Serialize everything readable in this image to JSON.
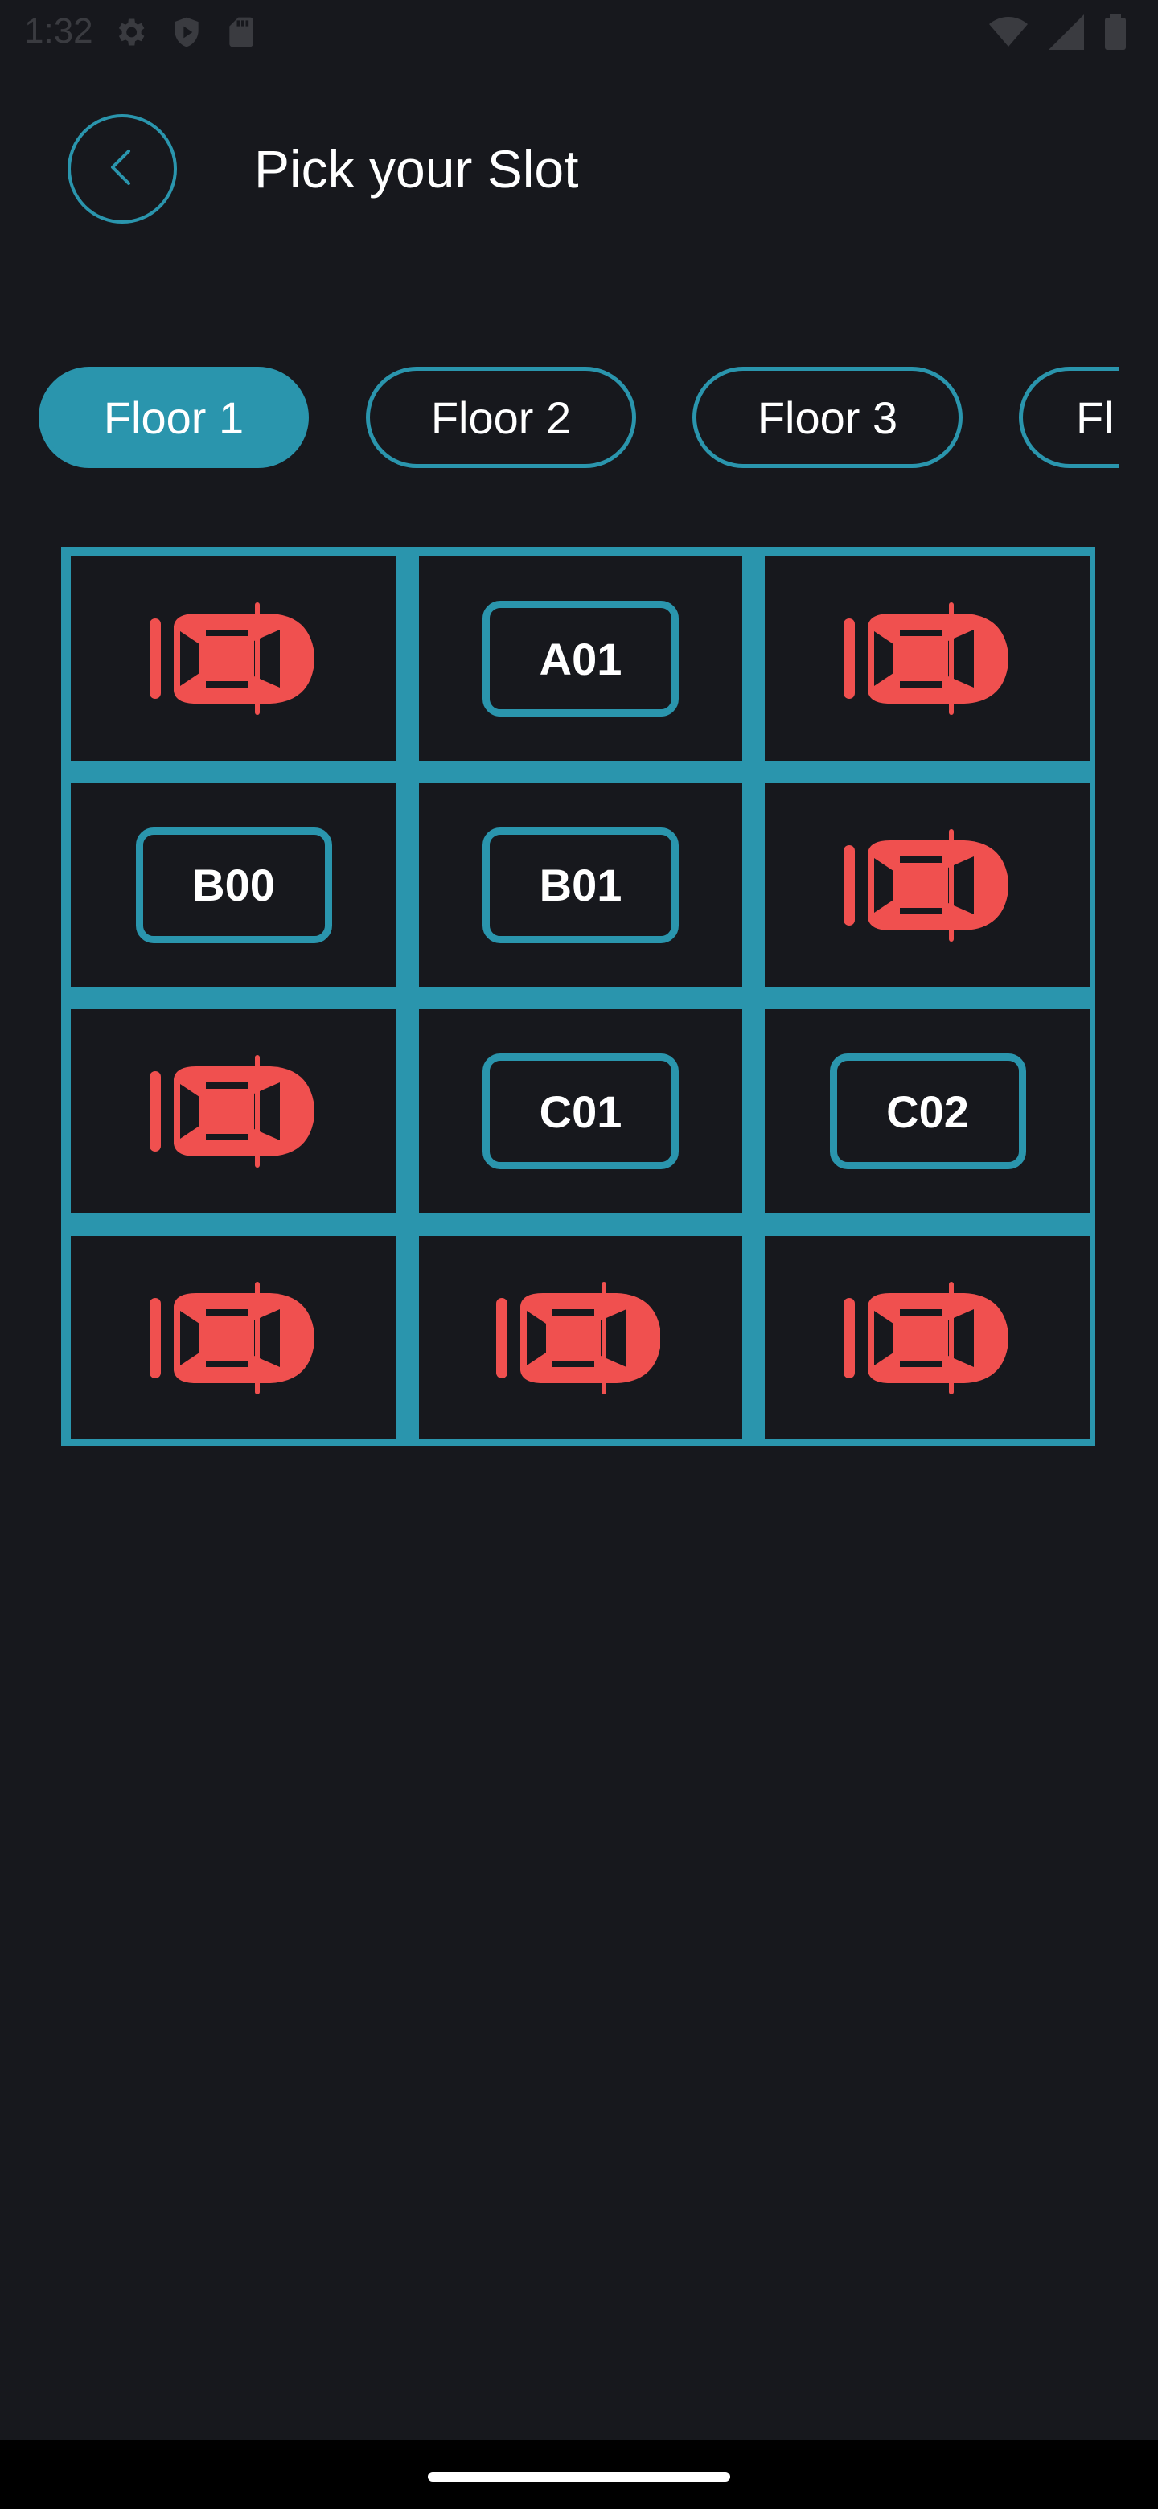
{
  "status_bar": {
    "time": "1:32",
    "left_icons": [
      "gear-icon",
      "shield-play-icon",
      "sd-card-icon"
    ],
    "right_icons": [
      "wifi-icon",
      "signal-icon",
      "battery-icon"
    ]
  },
  "header": {
    "back_icon": "chevron-left-icon",
    "title": "Pick your Slot"
  },
  "floors": [
    {
      "label": "Floor 1",
      "active": true
    },
    {
      "label": "Floor 2",
      "active": false
    },
    {
      "label": "Floor 3",
      "active": false
    },
    {
      "label": "Fl",
      "active": false
    }
  ],
  "slots": [
    {
      "status": "occupied"
    },
    {
      "status": "available",
      "label": "A01"
    },
    {
      "status": "occupied"
    },
    {
      "status": "available",
      "label": "B00"
    },
    {
      "status": "available",
      "label": "B01"
    },
    {
      "status": "occupied"
    },
    {
      "status": "occupied"
    },
    {
      "status": "available",
      "label": "C01"
    },
    {
      "status": "available",
      "label": "C02"
    },
    {
      "status": "occupied"
    },
    {
      "status": "occupied"
    },
    {
      "status": "occupied"
    }
  ],
  "colors": {
    "background": "#17181d",
    "accent": "#2a95ad",
    "occupied_car": "#f0504f",
    "text": "#ffffff"
  }
}
